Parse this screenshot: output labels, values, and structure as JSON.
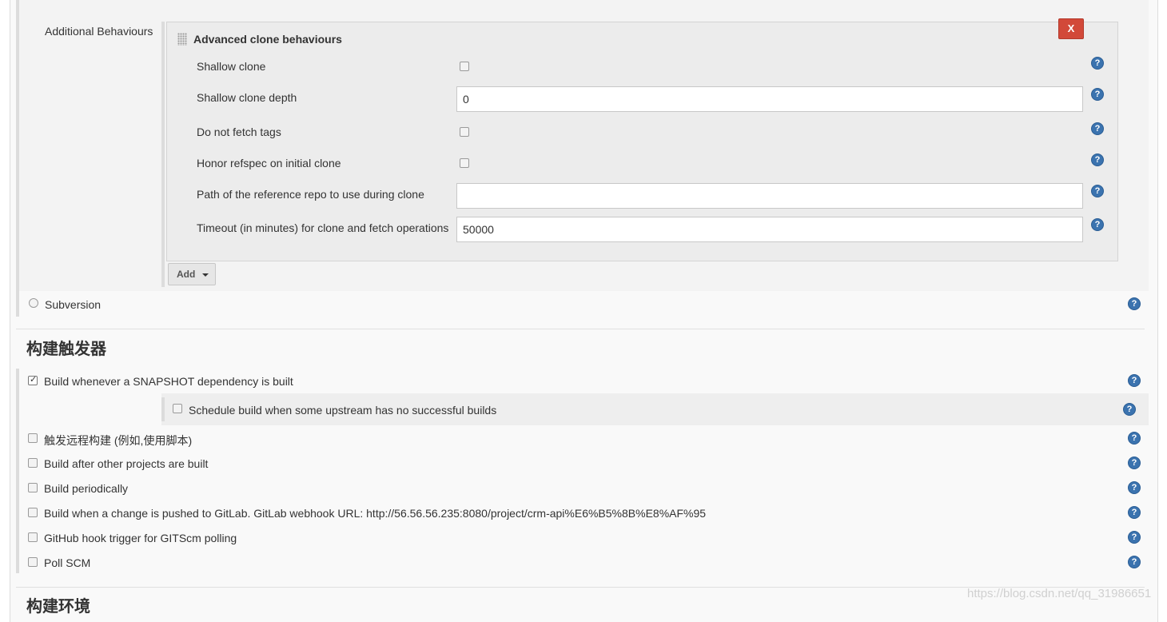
{
  "git": {
    "additional_behaviours_label": "Additional Behaviours",
    "advanced": {
      "title": "Advanced clone behaviours",
      "delete_label": "X",
      "rows": [
        {
          "label": "Shallow clone",
          "type": "checkbox",
          "checked": false
        },
        {
          "label": "Shallow clone depth",
          "type": "text",
          "value": "0"
        },
        {
          "label": "Do not fetch tags",
          "type": "checkbox",
          "checked": false
        },
        {
          "label": "Honor refspec on initial clone",
          "type": "checkbox",
          "checked": false
        },
        {
          "label": "Path of the reference repo to use during clone",
          "type": "text",
          "value": ""
        },
        {
          "label": "Timeout (in minutes) for clone and fetch operations",
          "type": "text",
          "value": "50000"
        }
      ]
    },
    "add_button_label": "Add",
    "subversion_label": "Subversion"
  },
  "triggers": {
    "section_title": "构建触发器",
    "snapshot": {
      "label": "Build whenever a SNAPSHOT dependency is built",
      "checked": true
    },
    "schedule_upstream": {
      "label": "Schedule build when some upstream has no successful builds",
      "checked": false
    },
    "items": [
      {
        "label": "触发远程构建 (例如,使用脚本)",
        "checked": false
      },
      {
        "label": "Build after other projects are built",
        "checked": false
      },
      {
        "label": "Build periodically",
        "checked": false
      },
      {
        "label": "Build when a change is pushed to GitLab. GitLab webhook URL: http://56.56.56.235:8080/project/crm-api%E6%B5%8B%E8%AF%95",
        "checked": false
      },
      {
        "label": "GitHub hook trigger for GITScm polling",
        "checked": false
      },
      {
        "label": "Poll SCM",
        "checked": false
      }
    ]
  },
  "environment": {
    "section_title": "构建环境"
  },
  "help_glyph": "?",
  "watermark": "https://blog.csdn.net/qq_31986651",
  "icons": {
    "help": "help-icon",
    "drag": "drag-handle-icon",
    "dropdown": "caret-down-icon",
    "delete": "close-icon"
  },
  "colors": {
    "help": "#3b73af",
    "delete": "#d24939",
    "panel": "#f9f9f9",
    "block": "#eeeeee"
  }
}
